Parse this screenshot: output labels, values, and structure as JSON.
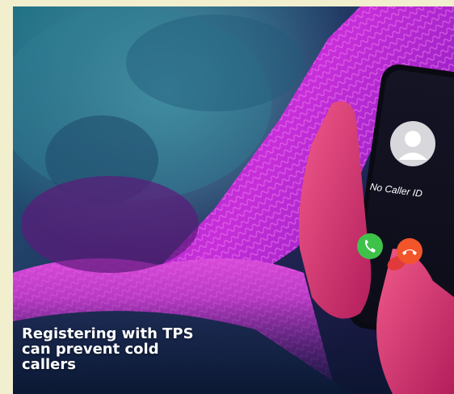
{
  "photo": {
    "caption": "Registering with TPS can prevent cold callers",
    "phone_screen": {
      "caller_label": "No Caller ID"
    },
    "icons": {
      "caller_avatar": "person-silhouette-icon",
      "answer_call": "phone-answer-icon",
      "decline_call": "phone-decline-icon"
    }
  },
  "colors": {
    "page_background": "#f2efcf",
    "answer_green": "#3fc24a",
    "decline_orange": "#f2552a",
    "sweater_magenta": "#c22ad6"
  }
}
